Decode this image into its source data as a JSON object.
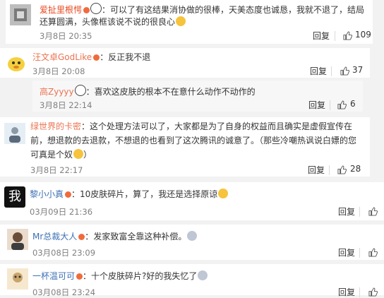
{
  "comments": [
    {
      "user": "爱扯里根愕",
      "colon": "：",
      "text1": "可以了有这结果消协做的很棒，天美态度也诚恳，我就不退了，结局",
      "text2": "还算圆满，头像框该说不说的很良心",
      "time": "3月8日 20:35",
      "reply": "回复",
      "likes": "109"
    },
    {
      "user": "汪文卓GodLike",
      "colon": "：",
      "text1": "反正我不退",
      "time": "3月8日 20:08",
      "reply": "回复",
      "likes": "37"
    },
    {
      "user": "高Zyyyy",
      "colon": "：",
      "text1": "喜欢这皮肤的根本不在意什么动作不动作的",
      "time": "3月8日 22:14",
      "reply": "回复",
      "likes": "6"
    },
    {
      "user": "绿世界的卡密",
      "colon": "：",
      "text1": "这个处理方法可以了，大家都是为了自身的权益而且确实是虚假宣传在",
      "text2": "前，想退款的去退款，不想退的也看到了这次腾讯的诚意了。（那些冷嘲热讽说白嫖的您",
      "text3": "可真是个奴",
      "time": "3月8日 22:17",
      "reply": "回复",
      "likes": "28"
    },
    {
      "user": "黎小小真",
      "colon": "：",
      "text1": "10皮肤碎片，算了，我还是选择原谅",
      "time": "03月09日 21:36",
      "reply": "回复",
      "avatar_text": "我"
    },
    {
      "user": "Mr总裁大人",
      "colon": "：",
      "text1": "发家致富全靠这种补偿。",
      "time": "03月08日 23:09",
      "reply": "回复"
    },
    {
      "user": "一杯温可可",
      "colon": "：",
      "text1": "十个皮肤碎片?好的我失忆了",
      "time": "03月08日 23:24",
      "reply": "回复"
    }
  ],
  "colors": {
    "orange_name": "#eb7350",
    "blue_name": "#3c6fb5",
    "background": "#f2f2f2"
  },
  "icons": [
    "avatar",
    "vip-badge",
    "panda-emoji",
    "smile-emoji",
    "thumbs-up-icon"
  ]
}
